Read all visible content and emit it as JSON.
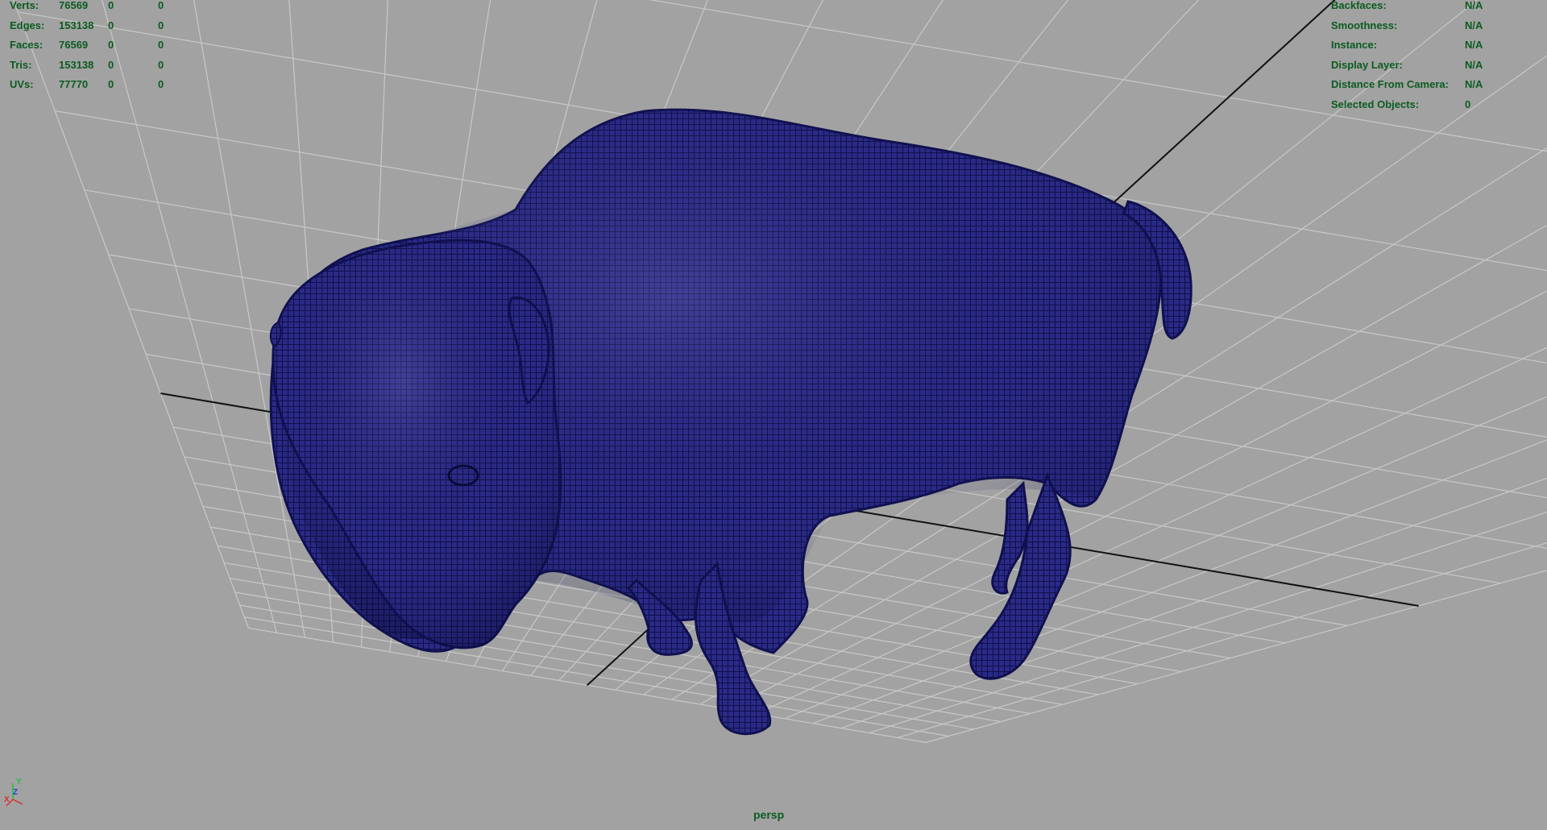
{
  "viewport": {
    "camera": "persp",
    "background": "#a2a2a2",
    "grid_color": "#c8c8c8",
    "axis_line_color": "#111111",
    "mesh_fill": "#24247e",
    "mesh_wire": "#101050",
    "hud_text_color": "#0b5b20"
  },
  "poly_count": [
    {
      "label": "Verts:",
      "values": [
        "76569",
        "0",
        "0"
      ]
    },
    {
      "label": "Edges:",
      "values": [
        "153138",
        "0",
        "0"
      ]
    },
    {
      "label": "Faces:",
      "values": [
        "76569",
        "0",
        "0"
      ]
    },
    {
      "label": "Tris:",
      "values": [
        "153138",
        "0",
        "0"
      ]
    },
    {
      "label": "UVs:",
      "values": [
        "77770",
        "0",
        "0"
      ]
    }
  ],
  "object_details": [
    {
      "label": "Backfaces:",
      "value": "N/A"
    },
    {
      "label": "Smoothness:",
      "value": "N/A"
    },
    {
      "label": "Instance:",
      "value": "N/A"
    },
    {
      "label": "Display Layer:",
      "value": "N/A"
    },
    {
      "label": "Distance From Camera:",
      "value": "N/A"
    },
    {
      "label": "Selected Objects:",
      "value": "0"
    }
  ],
  "axis_indicator": {
    "labels": [
      "X",
      "Y",
      "Z"
    ],
    "colors": {
      "X": "#d83030",
      "Y": "#20c040",
      "Z": "#2040d0"
    },
    "icon": "view-axis-gizmo-icon"
  },
  "model": {
    "icon": "bison-wireframe-mesh"
  }
}
